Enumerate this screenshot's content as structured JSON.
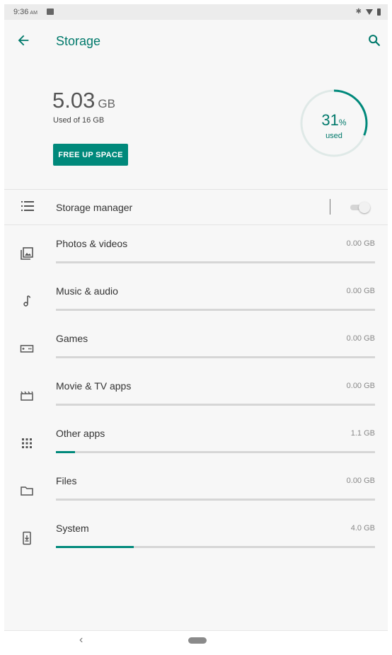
{
  "status_bar": {
    "time": "9:36",
    "ampm": "AM",
    "icons": [
      "notification-icon",
      "bluetooth-icon",
      "wifi-icon",
      "battery-icon"
    ]
  },
  "app_bar": {
    "title": "Storage",
    "back_icon": "arrow-back-icon",
    "search_icon": "search-icon"
  },
  "summary": {
    "used_value": "5.03",
    "used_unit": "GB",
    "used_of": "Used of 16 GB",
    "free_up_label": "FREE UP SPACE",
    "percent_value": "31",
    "percent_sign": "%",
    "percent_label": "used",
    "percent_fraction": 0.31
  },
  "storage_manager": {
    "label": "Storage manager",
    "enabled": false,
    "icon": "list-icon"
  },
  "categories": [
    {
      "label": "Photos & videos",
      "size": "0.00 GB",
      "fraction": 0.0,
      "icon": "photos-icon"
    },
    {
      "label": "Music & audio",
      "size": "0.00 GB",
      "fraction": 0.0,
      "icon": "music-note-icon"
    },
    {
      "label": "Games",
      "size": "0.00 GB",
      "fraction": 0.0,
      "icon": "gamepad-icon"
    },
    {
      "label": "Movie & TV apps",
      "size": "0.00 GB",
      "fraction": 0.0,
      "icon": "movie-icon"
    },
    {
      "label": "Other apps",
      "size": "1.1 GB",
      "fraction": 0.06,
      "icon": "apps-grid-icon"
    },
    {
      "label": "Files",
      "size": "0.00 GB",
      "fraction": 0.0,
      "icon": "folder-icon"
    },
    {
      "label": "System",
      "size": "4.0 GB",
      "fraction": 0.245,
      "icon": "system-update-icon"
    }
  ],
  "nav_bar": {
    "back_glyph": "‹"
  },
  "colors": {
    "accent": "#00897b",
    "accent_dark": "#00796b",
    "track": "#d6d6d6"
  }
}
